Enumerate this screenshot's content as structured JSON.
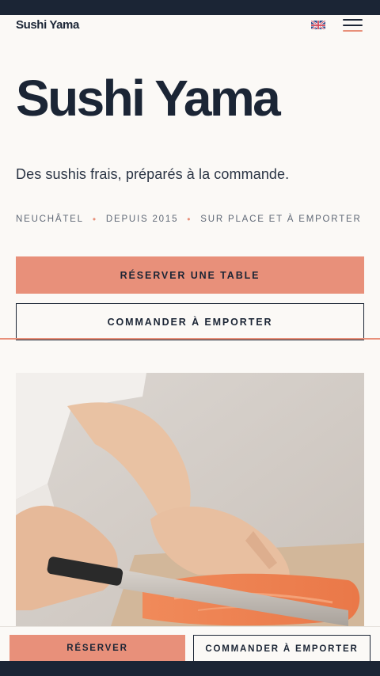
{
  "header": {
    "logo": "Sushi Yama",
    "language_icon": "uk-flag-icon",
    "menu_icon": "hamburger-menu-icon"
  },
  "hero": {
    "title": "Sushi Yama",
    "tagline": "Des sushis frais, préparés à la commande.",
    "meta": [
      "NEUCHÂTEL",
      "DEPUIS 2015",
      "SUR PLACE ET À EMPORTER"
    ],
    "meta_separator": "•"
  },
  "actions": {
    "reserve_label": "RÉSERVER UNE TABLE",
    "order_label": "COMMANDER À EMPORTER"
  },
  "bottom_bar": {
    "reserve_label": "RÉSERVER",
    "order_label": "COMMANDER À EMPORTER"
  },
  "colors": {
    "accent": "#e8907a",
    "navy": "#1b2535",
    "background": "#fbf9f6"
  }
}
